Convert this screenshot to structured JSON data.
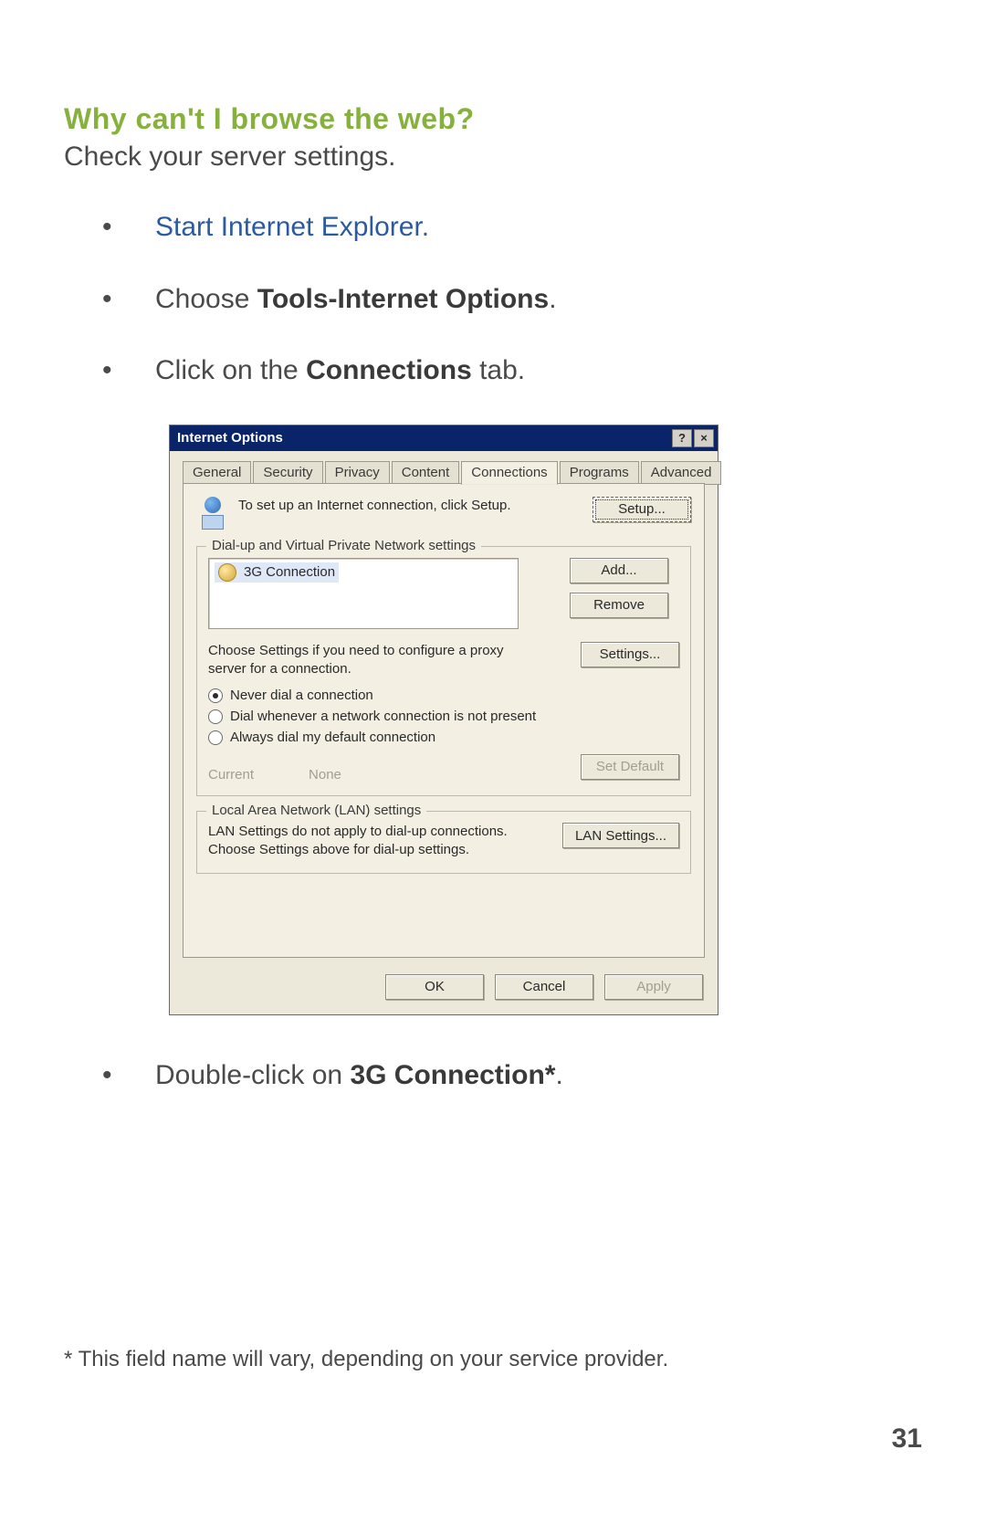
{
  "doc": {
    "heading": "Why can't I browse the web?",
    "subheading": "Check your server settings.",
    "bullets": {
      "b1": "Start Internet Explorer.",
      "b2_pre": "Choose ",
      "b2_bold": "Tools-Internet Options",
      "b2_post": ".",
      "b3_pre": "Click on the ",
      "b3_bold": "Connections",
      "b3_post": " tab.",
      "b4_pre": "Double-click on ",
      "b4_bold": "3G Connection*",
      "b4_post": "."
    },
    "footnote": "* This field name will vary, depending on your service provider.",
    "pagenum": "31"
  },
  "dialog": {
    "title": "Internet Options",
    "help_glyph": "?",
    "close_glyph": "×",
    "tabs": {
      "general": "General",
      "security": "Security",
      "privacy": "Privacy",
      "content": "Content",
      "connections": "Connections",
      "programs": "Programs",
      "advanced": "Advanced"
    },
    "setup_text": "To set up an Internet connection, click Setup.",
    "setup_btn": "Setup...",
    "group_dialup": "Dial-up and Virtual Private Network settings",
    "conn_item": "3G Connection",
    "btn_add": "Add...",
    "btn_remove": "Remove",
    "proxy_text": "Choose Settings if you need to configure a proxy server for a connection.",
    "btn_settings": "Settings...",
    "radio_never": "Never dial a connection",
    "radio_whenever": "Dial whenever a network connection is not present",
    "radio_always": "Always dial my default connection",
    "current_label": "Current",
    "current_value": "None",
    "btn_setdefault": "Set Default",
    "group_lan": "Local Area Network (LAN) settings",
    "lan_text": "LAN Settings do not apply to dial-up connections. Choose Settings above for dial-up settings.",
    "btn_lan": "LAN Settings...",
    "btn_ok": "OK",
    "btn_cancel": "Cancel",
    "btn_apply": "Apply"
  }
}
